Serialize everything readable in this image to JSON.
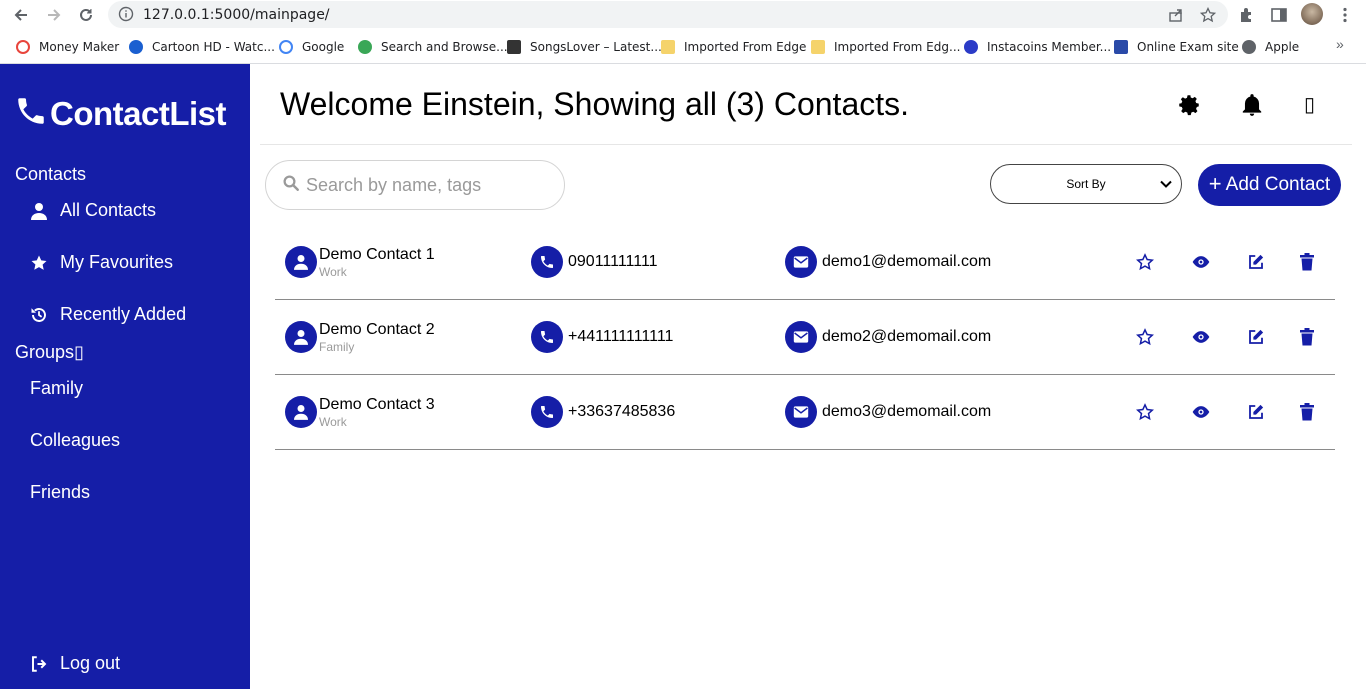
{
  "browser": {
    "url": "127.0.0.1:5000/mainpage/",
    "bookmarks": [
      {
        "label": "Money Maker",
        "color": "#e8453c"
      },
      {
        "label": "Cartoon HD - Watc...",
        "color": "#1a5fd0"
      },
      {
        "label": "Google",
        "color": "#4285f4"
      },
      {
        "label": "Search and Browse...",
        "color": "#3aa757"
      },
      {
        "label": "SongsLover – Latest...",
        "color": "#333333"
      },
      {
        "label": "Imported From Edge",
        "color": "#f5d36b"
      },
      {
        "label": "Imported From Edg...",
        "color": "#f5d36b"
      },
      {
        "label": "Instacoins Member...",
        "color": "#2b3bc7"
      },
      {
        "label": "Online Exam site",
        "color": "#2a4aa8"
      },
      {
        "label": "Apple",
        "color": "#5f6368"
      }
    ],
    "more": "»"
  },
  "sidebar": {
    "brand": "ContactList",
    "contacts_label": "Contacts",
    "nav": [
      {
        "label": "All Contacts",
        "icon": "user-icon"
      },
      {
        "label": "My Favourites",
        "icon": "star-icon"
      },
      {
        "label": "Recently Added",
        "icon": "history-icon"
      }
    ],
    "groups_label": "Groups▯",
    "groups": [
      "Family",
      "Colleagues",
      "Friends"
    ],
    "logout": "Log out"
  },
  "header": {
    "welcome": "Welcome Einstein, Showing all (3) Contacts.",
    "extra_icon": "▯"
  },
  "toolbar": {
    "search_placeholder": "Search by name, tags",
    "sort_label": "Sort By",
    "add_label": "Add Contact"
  },
  "contacts": [
    {
      "name": "Demo Contact 1",
      "tag": "Work",
      "phone": "09011111111",
      "email": "demo1@demomail.com"
    },
    {
      "name": "Demo Contact 2",
      "tag": "Family",
      "phone": "+441111111111",
      "email": "demo2@demomail.com"
    },
    {
      "name": "Demo Contact 3",
      "tag": "Work",
      "phone": "+33637485836",
      "email": "demo3@demomail.com"
    }
  ],
  "colors": {
    "primary": "#151ea7"
  }
}
